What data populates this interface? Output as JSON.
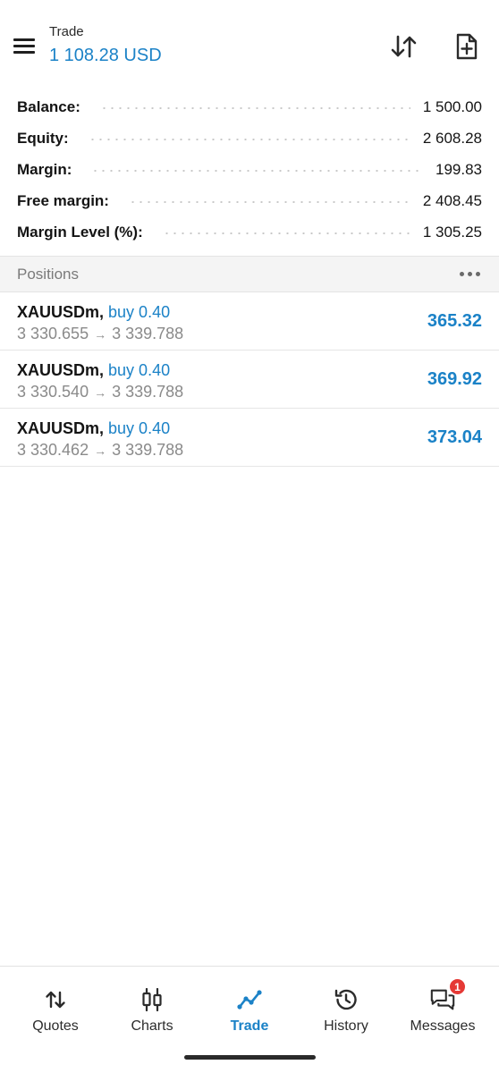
{
  "header": {
    "title": "Trade",
    "subtitle": "1 108.28 USD"
  },
  "summary": [
    {
      "label": "Balance:",
      "value": "1 500.00"
    },
    {
      "label": "Equity:",
      "value": "2 608.28"
    },
    {
      "label": "Margin:",
      "value": "199.83"
    },
    {
      "label": "Free margin:",
      "value": "2 408.45"
    },
    {
      "label": "Margin Level (%):",
      "value": "1 305.25"
    }
  ],
  "positions_header": {
    "label": "Positions"
  },
  "positions": [
    {
      "symbol": "XAUUSDm,",
      "side": "buy 0.40",
      "open_price": "3 330.655",
      "arrow": "→",
      "current_price": "3 339.788",
      "profit": "365.32"
    },
    {
      "symbol": "XAUUSDm,",
      "side": "buy 0.40",
      "open_price": "3 330.540",
      "arrow": "→",
      "current_price": "3 339.788",
      "profit": "369.92"
    },
    {
      "symbol": "XAUUSDm,",
      "side": "buy 0.40",
      "open_price": "3 330.462",
      "arrow": "→",
      "current_price": "3 339.788",
      "profit": "373.04"
    }
  ],
  "bottom_nav": [
    {
      "label": "Quotes",
      "icon": "quotes-arrows-icon"
    },
    {
      "label": "Charts",
      "icon": "candlestick-icon"
    },
    {
      "label": "Trade",
      "icon": "trade-line-icon",
      "active": true
    },
    {
      "label": "History",
      "icon": "history-clock-icon"
    },
    {
      "label": "Messages",
      "icon": "messages-chat-icon",
      "badge": "1"
    }
  ],
  "colors": {
    "accent": "#1b82c7",
    "badge": "#e53935",
    "muted": "#8a8a8a"
  }
}
